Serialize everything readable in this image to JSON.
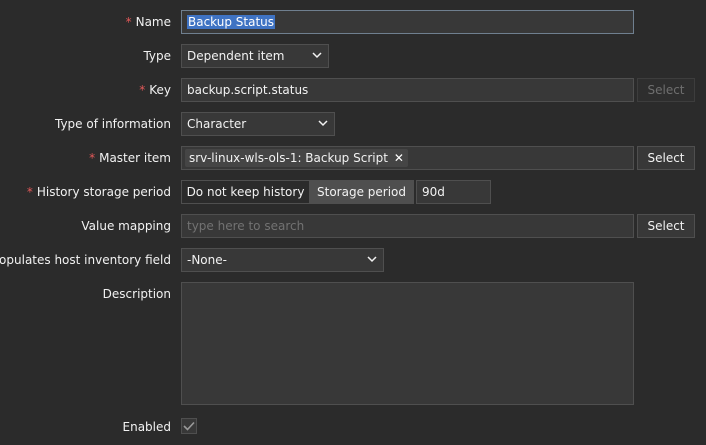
{
  "form": {
    "name": {
      "label": "Name",
      "value": "Backup Status"
    },
    "type": {
      "label": "Type",
      "value": "Dependent item"
    },
    "key": {
      "label": "Key",
      "value": "backup.script.status",
      "select_label": "Select"
    },
    "type_of_information": {
      "label": "Type of information",
      "value": "Character"
    },
    "master_item": {
      "label": "Master item",
      "value": "srv-linux-wls-ols-1: Backup Script",
      "select_label": "Select"
    },
    "history": {
      "label": "History storage period",
      "option_off": "Do not keep history",
      "option_on": "Storage period",
      "value": "90d"
    },
    "value_mapping": {
      "label": "Value mapping",
      "placeholder": "type here to search",
      "select_label": "Select"
    },
    "inventory": {
      "label": "Populates host inventory field",
      "value": "-None-"
    },
    "description": {
      "label": "Description",
      "value": ""
    },
    "enabled": {
      "label": "Enabled",
      "checked": true
    }
  },
  "icons": {
    "dropdown": "chevron-down-icon",
    "remove": "close-icon",
    "check": "check-icon"
  },
  "colors": {
    "background": "#2b2b2b",
    "field_bg": "#383838",
    "border": "#4f4f4f",
    "required": "#e45959",
    "selection": "#3f73c3"
  }
}
